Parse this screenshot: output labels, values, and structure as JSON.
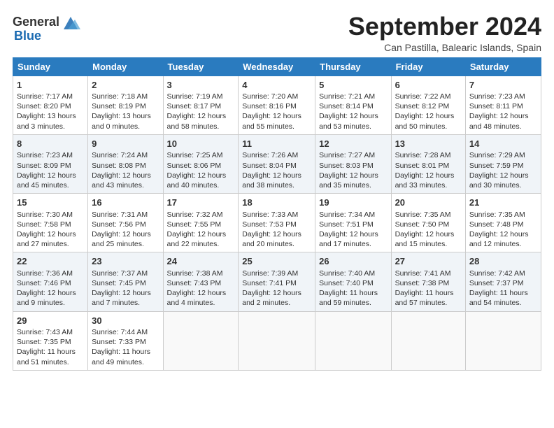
{
  "logo": {
    "general": "General",
    "blue": "Blue"
  },
  "header": {
    "month": "September 2024",
    "location": "Can Pastilla, Balearic Islands, Spain"
  },
  "weekdays": [
    "Sunday",
    "Monday",
    "Tuesday",
    "Wednesday",
    "Thursday",
    "Friday",
    "Saturday"
  ],
  "weeks": [
    [
      {
        "day": "1",
        "info": "Sunrise: 7:17 AM\nSunset: 8:20 PM\nDaylight: 13 hours\nand 3 minutes."
      },
      {
        "day": "2",
        "info": "Sunrise: 7:18 AM\nSunset: 8:19 PM\nDaylight: 13 hours\nand 0 minutes."
      },
      {
        "day": "3",
        "info": "Sunrise: 7:19 AM\nSunset: 8:17 PM\nDaylight: 12 hours\nand 58 minutes."
      },
      {
        "day": "4",
        "info": "Sunrise: 7:20 AM\nSunset: 8:16 PM\nDaylight: 12 hours\nand 55 minutes."
      },
      {
        "day": "5",
        "info": "Sunrise: 7:21 AM\nSunset: 8:14 PM\nDaylight: 12 hours\nand 53 minutes."
      },
      {
        "day": "6",
        "info": "Sunrise: 7:22 AM\nSunset: 8:12 PM\nDaylight: 12 hours\nand 50 minutes."
      },
      {
        "day": "7",
        "info": "Sunrise: 7:23 AM\nSunset: 8:11 PM\nDaylight: 12 hours\nand 48 minutes."
      }
    ],
    [
      {
        "day": "8",
        "info": "Sunrise: 7:23 AM\nSunset: 8:09 PM\nDaylight: 12 hours\nand 45 minutes."
      },
      {
        "day": "9",
        "info": "Sunrise: 7:24 AM\nSunset: 8:08 PM\nDaylight: 12 hours\nand 43 minutes."
      },
      {
        "day": "10",
        "info": "Sunrise: 7:25 AM\nSunset: 8:06 PM\nDaylight: 12 hours\nand 40 minutes."
      },
      {
        "day": "11",
        "info": "Sunrise: 7:26 AM\nSunset: 8:04 PM\nDaylight: 12 hours\nand 38 minutes."
      },
      {
        "day": "12",
        "info": "Sunrise: 7:27 AM\nSunset: 8:03 PM\nDaylight: 12 hours\nand 35 minutes."
      },
      {
        "day": "13",
        "info": "Sunrise: 7:28 AM\nSunset: 8:01 PM\nDaylight: 12 hours\nand 33 minutes."
      },
      {
        "day": "14",
        "info": "Sunrise: 7:29 AM\nSunset: 7:59 PM\nDaylight: 12 hours\nand 30 minutes."
      }
    ],
    [
      {
        "day": "15",
        "info": "Sunrise: 7:30 AM\nSunset: 7:58 PM\nDaylight: 12 hours\nand 27 minutes."
      },
      {
        "day": "16",
        "info": "Sunrise: 7:31 AM\nSunset: 7:56 PM\nDaylight: 12 hours\nand 25 minutes."
      },
      {
        "day": "17",
        "info": "Sunrise: 7:32 AM\nSunset: 7:55 PM\nDaylight: 12 hours\nand 22 minutes."
      },
      {
        "day": "18",
        "info": "Sunrise: 7:33 AM\nSunset: 7:53 PM\nDaylight: 12 hours\nand 20 minutes."
      },
      {
        "day": "19",
        "info": "Sunrise: 7:34 AM\nSunset: 7:51 PM\nDaylight: 12 hours\nand 17 minutes."
      },
      {
        "day": "20",
        "info": "Sunrise: 7:35 AM\nSunset: 7:50 PM\nDaylight: 12 hours\nand 15 minutes."
      },
      {
        "day": "21",
        "info": "Sunrise: 7:35 AM\nSunset: 7:48 PM\nDaylight: 12 hours\nand 12 minutes."
      }
    ],
    [
      {
        "day": "22",
        "info": "Sunrise: 7:36 AM\nSunset: 7:46 PM\nDaylight: 12 hours\nand 9 minutes."
      },
      {
        "day": "23",
        "info": "Sunrise: 7:37 AM\nSunset: 7:45 PM\nDaylight: 12 hours\nand 7 minutes."
      },
      {
        "day": "24",
        "info": "Sunrise: 7:38 AM\nSunset: 7:43 PM\nDaylight: 12 hours\nand 4 minutes."
      },
      {
        "day": "25",
        "info": "Sunrise: 7:39 AM\nSunset: 7:41 PM\nDaylight: 12 hours\nand 2 minutes."
      },
      {
        "day": "26",
        "info": "Sunrise: 7:40 AM\nSunset: 7:40 PM\nDaylight: 11 hours\nand 59 minutes."
      },
      {
        "day": "27",
        "info": "Sunrise: 7:41 AM\nSunset: 7:38 PM\nDaylight: 11 hours\nand 57 minutes."
      },
      {
        "day": "28",
        "info": "Sunrise: 7:42 AM\nSunset: 7:37 PM\nDaylight: 11 hours\nand 54 minutes."
      }
    ],
    [
      {
        "day": "29",
        "info": "Sunrise: 7:43 AM\nSunset: 7:35 PM\nDaylight: 11 hours\nand 51 minutes."
      },
      {
        "day": "30",
        "info": "Sunrise: 7:44 AM\nSunset: 7:33 PM\nDaylight: 11 hours\nand 49 minutes."
      },
      null,
      null,
      null,
      null,
      null
    ]
  ]
}
